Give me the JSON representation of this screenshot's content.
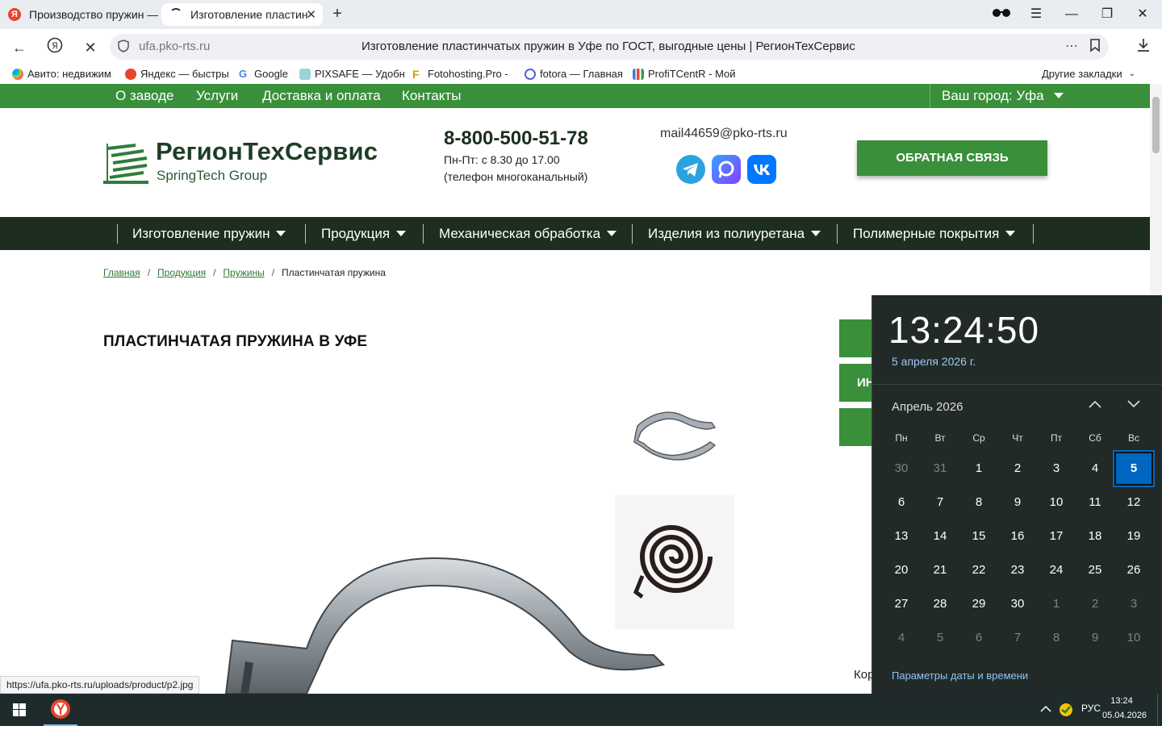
{
  "browser": {
    "tabs": [
      {
        "title": "Производство пружин —"
      },
      {
        "title": "Изготовление пластин"
      }
    ],
    "new_tab": "+",
    "url": "ufa.pko-rts.ru",
    "page_title": "Изготовление пластинчатых пружин в Уфе по ГОСТ, выгодные цены | РегионТехСервис",
    "bookmarks": [
      "Авито: недвижим",
      "Яндекс — быстры",
      "Google",
      "PIXSAFE — Удобн",
      "Fotohosting.Pro - ",
      "fotora — Главная",
      "ProfiTCentR - Мой"
    ],
    "other_bookmarks": "Другие закладки",
    "status_url": "https://ufa.pko-rts.ru/uploads/product/p2.jpg"
  },
  "site": {
    "topnav": [
      "О заводе",
      "Услуги",
      "Доставка и оплата",
      "Контакты"
    ],
    "city": "Ваш город: Уфа",
    "logo_name": "РегионТехСервис",
    "logo_sub": "SpringTech Group",
    "phone": "8-800-500-51-78",
    "hours": "Пн-Пт: с 8.30 до 17.00",
    "phone_note": "(телефон многоканальный)",
    "email": "mail44659@pko-rts.ru",
    "feedback_button": "ОБРАТНАЯ СВЯЗЬ",
    "mainnav": [
      "Изготовление пружин",
      "Продукция",
      "Механическая обработка",
      "Изделия из полиуретана",
      "Полимерные покрытия"
    ],
    "breadcrumb": [
      "Главная",
      "Продукция",
      "Пружины",
      "Пластинчатая пружина"
    ],
    "breadcrumb_sep": "/",
    "heading": "ПЛАСТИНЧАТАЯ ПРУЖИНА В УФЕ",
    "side_buttons": [
      "",
      "ИН",
      ""
    ],
    "partial_text": "Кор"
  },
  "calendar": {
    "time": "13:24:50",
    "date": "5 апреля 2026 г.",
    "month": "Апрель 2026",
    "weekdays": [
      "Пн",
      "Вт",
      "Ср",
      "Чт",
      "Пт",
      "Сб",
      "Вс"
    ],
    "weeks": [
      [
        "30",
        "31",
        "1",
        "2",
        "3",
        "4",
        "5"
      ],
      [
        "6",
        "7",
        "8",
        "9",
        "10",
        "11",
        "12"
      ],
      [
        "13",
        "14",
        "15",
        "16",
        "17",
        "18",
        "19"
      ],
      [
        "20",
        "21",
        "22",
        "23",
        "24",
        "25",
        "26"
      ],
      [
        "27",
        "28",
        "29",
        "30",
        "1",
        "2",
        "3"
      ],
      [
        "4",
        "5",
        "6",
        "7",
        "8",
        "9",
        "10"
      ]
    ],
    "today": "5",
    "settings_link": "Параметры даты и времени"
  },
  "taskbar": {
    "lang": "РУС",
    "time": "13:24",
    "date": "05.04.2026"
  },
  "colors": {
    "brand_green": "#3a8f3b",
    "dark_nav": "#1e2e1e",
    "calendar_bg": "#222a27",
    "accent_blue": "#0067c0"
  },
  "icons": [
    "yandex-icon",
    "telegram-icon",
    "max-icon",
    "vk-icon",
    "windows-start-icon",
    "bookmark-icon",
    "download-icon",
    "refresh-stop-icon"
  ]
}
